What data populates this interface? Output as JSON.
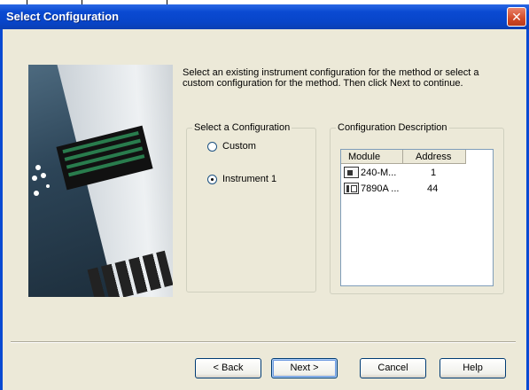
{
  "window": {
    "title": "Select Configuration",
    "close_glyph": "✕"
  },
  "instructions": "Select an existing instrument configuration for the method or select a custom configuration for the method. Then click Next to continue.",
  "config_group": {
    "label": "Select a Configuration",
    "options": [
      {
        "label": "Custom",
        "selected": false
      },
      {
        "label": "Instrument 1",
        "selected": true
      }
    ]
  },
  "description_group": {
    "label": "Configuration Description",
    "columns": [
      "Module",
      "Address"
    ],
    "rows": [
      {
        "icon": "autosampler-icon",
        "module": "240-M...",
        "address": "1"
      },
      {
        "icon": "gc-icon",
        "module": "7890A ...",
        "address": "44"
      }
    ]
  },
  "buttons": {
    "back": "< Back",
    "next": "Next >",
    "cancel": "Cancel",
    "help": "Help"
  },
  "colors": {
    "titlebar": "#0a4ad2",
    "dialog_bg": "#ece9d8",
    "close": "#d24a28"
  }
}
